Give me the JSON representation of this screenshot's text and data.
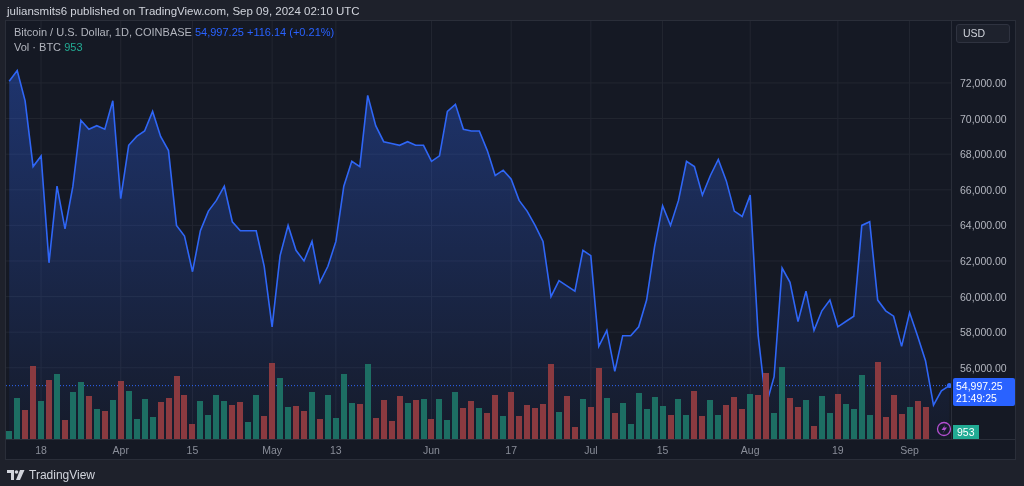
{
  "header": {
    "text": "juliansmits6 published on TradingView.com, Sep 09, 2024 02:10 UTC"
  },
  "legend": {
    "symbol": "Bitcoin / U.S. Dollar, 1D, COINBASE",
    "price": "54,997.25",
    "change": "+116.14 (+0.21%)",
    "volume_title": "Vol · BTC",
    "volume": "953"
  },
  "currency_button": "USD",
  "price_label": {
    "price": "54,997.25",
    "countdown": "21:49:25"
  },
  "volume_label": "953",
  "chart_data": {
    "type": "area",
    "grid": true,
    "ylim": [
      52000,
      75480
    ],
    "categories": [
      null,
      null,
      null,
      null,
      "18",
      null,
      null,
      null,
      null,
      null,
      null,
      null,
      null,
      null,
      "Apr",
      null,
      null,
      null,
      null,
      null,
      null,
      null,
      null,
      "15",
      null,
      null,
      null,
      null,
      null,
      null,
      null,
      null,
      null,
      "May",
      null,
      null,
      null,
      null,
      null,
      null,
      null,
      "13",
      null,
      null,
      null,
      null,
      null,
      null,
      null,
      null,
      null,
      null,
      null,
      "Jun",
      null,
      null,
      null,
      null,
      null,
      null,
      null,
      null,
      null,
      "17",
      null,
      null,
      null,
      null,
      null,
      null,
      null,
      null,
      null,
      "Jul",
      null,
      null,
      null,
      null,
      null,
      null,
      null,
      null,
      "15",
      null,
      null,
      null,
      null,
      null,
      null,
      null,
      null,
      null,
      null,
      "Aug",
      null,
      null,
      null,
      null,
      null,
      null,
      null,
      null,
      null,
      null,
      "19",
      null,
      null,
      null,
      null,
      null,
      null,
      null,
      null,
      "Sep",
      null,
      null,
      null,
      null,
      null
    ],
    "ref_lines": [
      {
        "axis": "y",
        "value": 54997.25
      }
    ],
    "series": [
      {
        "color": "#2f66f6",
        "values": [
          72100,
          72700,
          71000,
          67300,
          67900,
          61900,
          66200,
          63800,
          66200,
          69900,
          69400,
          69600,
          69400,
          71000,
          65500,
          68500,
          69000,
          69300,
          70400,
          69000,
          68200,
          64000,
          63400,
          61400,
          63700,
          64800,
          65400,
          66200,
          64200,
          63700,
          63700,
          63700,
          61700,
          58300,
          62300,
          64000,
          62600,
          62000,
          63100,
          60800,
          61700,
          63100,
          66200,
          67600,
          67300,
          71300,
          69600,
          68700,
          68600,
          68500,
          68700,
          68500,
          68500,
          67600,
          67900,
          70400,
          70800,
          69400,
          69300,
          69300,
          68200,
          66800,
          67100,
          66600,
          65400,
          64800,
          64000,
          63100,
          60000,
          60900,
          60600,
          60300,
          62600,
          62300,
          57200,
          58100,
          55800,
          57800,
          57800,
          58300,
          59800,
          62800,
          65100,
          64000,
          65400,
          67600,
          67300,
          65700,
          66800,
          67700,
          66500,
          64800,
          64500,
          65700,
          57800,
          53900,
          55500,
          61600,
          60800,
          58600,
          60300,
          58100,
          59200,
          59800,
          58300,
          58600,
          58900,
          64000,
          64200,
          59800,
          59200,
          58900,
          57200,
          59100,
          57800,
          56400,
          53900,
          54700,
          55000
        ]
      }
    ],
    "yticks": [
      {
        "value": 56000,
        "label": "56,000.00"
      },
      {
        "value": 58000,
        "label": "58,000.00"
      },
      {
        "value": 60000,
        "label": "60,000.00"
      },
      {
        "value": 62000,
        "label": "62,000.00"
      },
      {
        "value": 64000,
        "label": "64,000.00"
      },
      {
        "value": 66000,
        "label": "66,000.00"
      },
      {
        "value": 68000,
        "label": "68,000.00"
      },
      {
        "value": 70000,
        "label": "70,000.00"
      },
      {
        "value": 72000,
        "label": "72,000.00"
      }
    ]
  },
  "footer": {
    "brand": "TradingView"
  }
}
